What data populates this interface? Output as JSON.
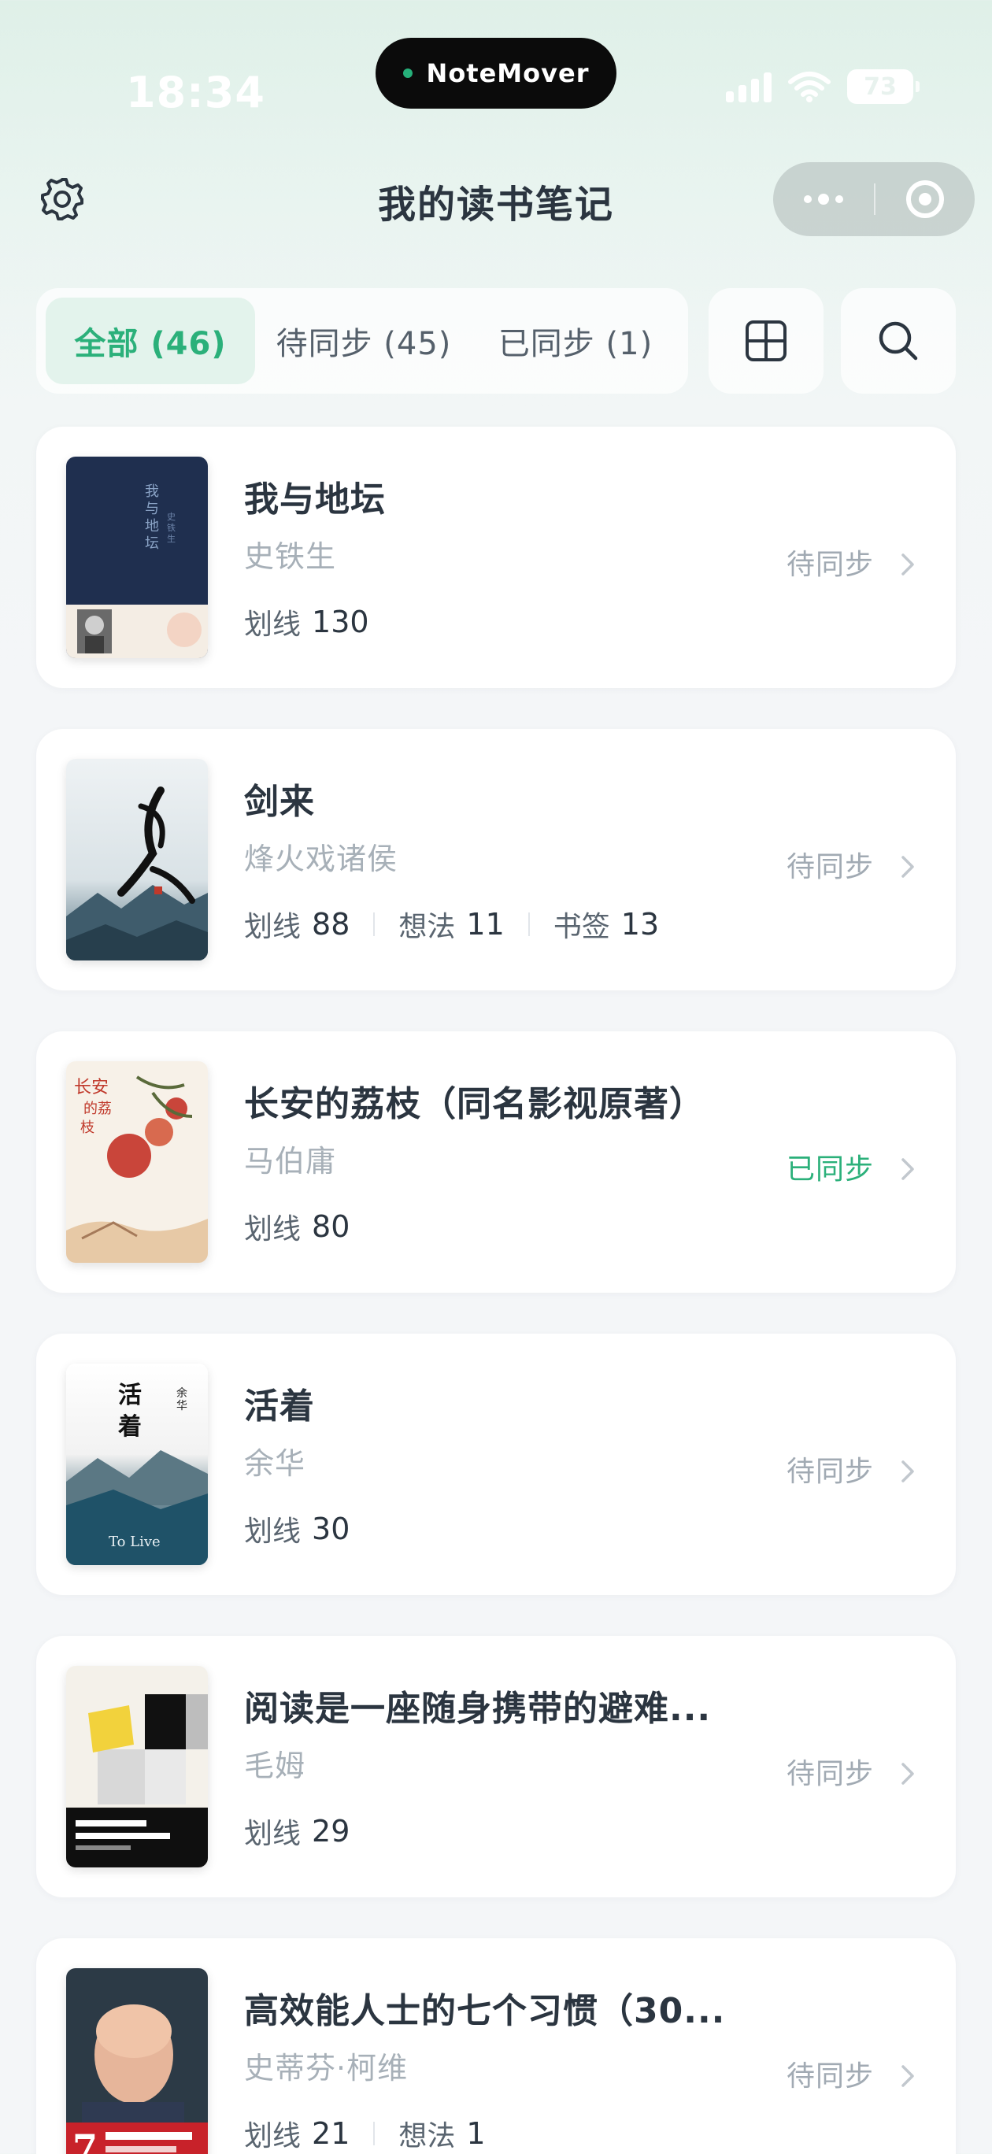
{
  "status_bar": {
    "time": "18:34",
    "island_label": "NoteMover",
    "battery": "73"
  },
  "header": {
    "title": "我的读书笔记",
    "settings_icon": "gear-icon",
    "more_icon": "more-dots-icon",
    "close_icon": "target-close-icon"
  },
  "filters": {
    "all": "全部 (46)",
    "pending": "待同步 (45)",
    "synced": "已同步 (1)",
    "active": "all",
    "grid_icon": "grid-view-icon",
    "search_icon": "search-icon"
  },
  "colors": {
    "accent": "#2bb07a",
    "pending_text": "#a1aab3",
    "title_text": "#2b3540"
  },
  "stat_labels": {
    "highlights": "划线",
    "thoughts": "想法",
    "bookmarks": "书签"
  },
  "books": [
    {
      "title": "我与地坛",
      "author": "史铁生",
      "status": "待同步",
      "highlights": "130"
    },
    {
      "title": "剑来",
      "author": "烽火戏诸侯",
      "status": "待同步",
      "highlights": "88",
      "thoughts": "11",
      "bookmarks": "13"
    },
    {
      "title": "长安的荔枝（同名影视原著）",
      "author": "马伯庸",
      "status": "已同步",
      "highlights": "80"
    },
    {
      "title": "活着",
      "author": "余华",
      "status": "待同步",
      "highlights": "30"
    },
    {
      "title": "阅读是一座随身携带的避难...",
      "author": "毛姆",
      "status": "待同步",
      "highlights": "29"
    },
    {
      "title": "高效能人士的七个习惯（30...",
      "author": "史蒂芬·柯维",
      "status": "待同步",
      "highlights": "21",
      "thoughts": "1"
    }
  ]
}
